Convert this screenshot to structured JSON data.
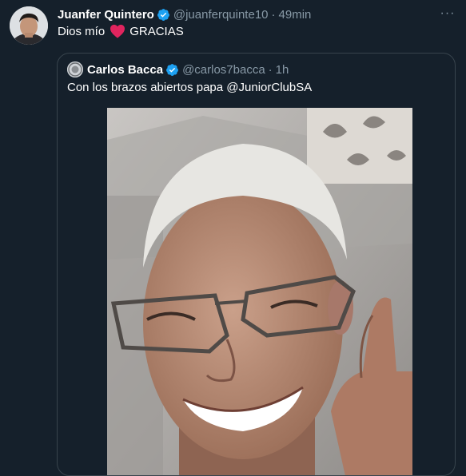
{
  "tweet": {
    "author_name": "Juanfer Quintero",
    "handle": "@juanferquinte10",
    "separator": "·",
    "time": "49min",
    "text_before": "Dios mío",
    "text_after": "GRACIAS",
    "more_label": "···"
  },
  "quoted": {
    "author_name": "Carlos Bacca",
    "handle": "@carlos7bacca",
    "separator": "·",
    "time": "1h",
    "text": "Con los brazos abiertos papa @JuniorClubSA"
  },
  "colors": {
    "background": "#15202b",
    "verified": "#1da1f2",
    "heart": "#e0245e",
    "border": "#38444d",
    "muted_text": "#8899a6"
  },
  "icons": {
    "verified": "verified-badge-icon",
    "heart": "red-heart-emoji",
    "more": "more-horizontal-icon"
  }
}
